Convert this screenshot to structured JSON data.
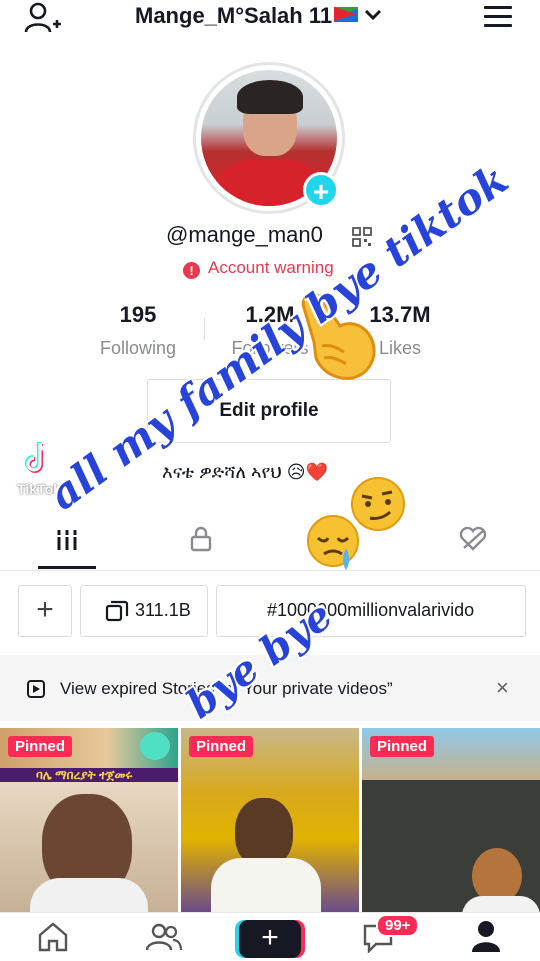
{
  "header": {
    "title": "Mange_M°Salah 11",
    "dropdown_icon": "chevron-down-icon",
    "left_icon": "add-user-icon",
    "right_icon": "menu-icon"
  },
  "profile": {
    "username": "@mange_man0",
    "warning": "Account warning",
    "edit_button": "Edit profile",
    "bio": "እናቴ ዎድሻለ ኣየህ 😥❤️"
  },
  "stats": [
    {
      "value": "195",
      "label": "Following"
    },
    {
      "value": "1.2M",
      "label": "Followers"
    },
    {
      "value": "13.7M",
      "label": "Likes"
    }
  ],
  "watermark": {
    "text": "TikTok"
  },
  "tabs": [
    {
      "icon": "grid-icon",
      "active": true
    },
    {
      "icon": "lock-icon",
      "active": false
    },
    {
      "icon": "heart-hidden-icon",
      "active": false
    }
  ],
  "chips": {
    "add_label": "+",
    "views_label": "311.1B",
    "hashtag_label": "#1000000millionvalarivido"
  },
  "notice": {
    "text": "View expired Stories in “Your private videos”",
    "close": "×"
  },
  "videos": [
    {
      "pinned": "Pinned",
      "caption": "ባሌ ማበረያት ተጀመሩ"
    },
    {
      "pinned": "Pinned",
      "caption": ""
    },
    {
      "pinned": "Pinned",
      "caption": ""
    }
  ],
  "bottom_nav": {
    "create": "+",
    "inbox_badge": "99+"
  },
  "overlay": {
    "line1": "all my family bye tiktok",
    "line2": "bye bye"
  },
  "colors": {
    "accent_red": "#fe2c55",
    "accent_cyan": "#20d5ec",
    "overlay_blue": "#2743d9",
    "warning_red": "#e8394e"
  }
}
